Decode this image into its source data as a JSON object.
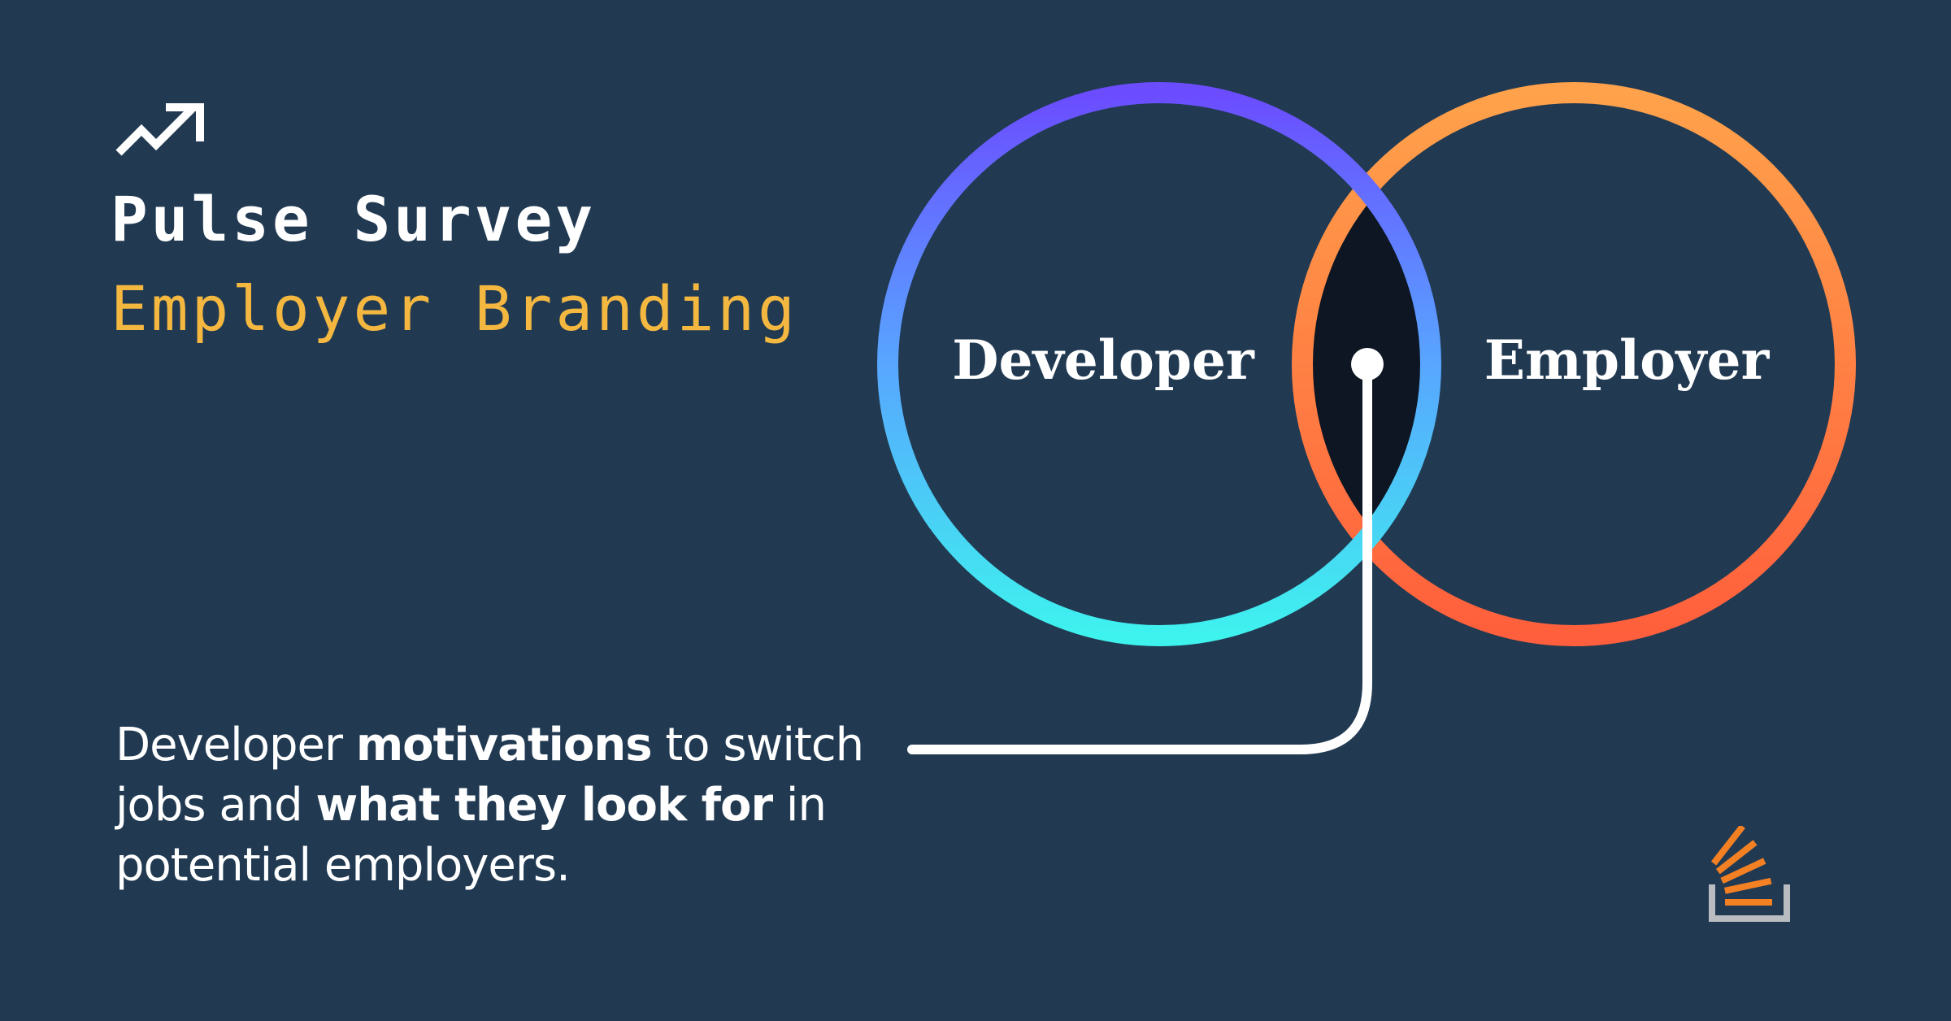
{
  "header": {
    "icon": "trending-up-icon",
    "title": "Pulse Survey",
    "subtitle": "Employer Branding"
  },
  "venn": {
    "left_label": "Developer",
    "right_label": "Employer",
    "left_gradient": [
      "#6b4cff",
      "#3ef2ee"
    ],
    "right_gradient": [
      "#ffa24b",
      "#ff5f3c"
    ],
    "overlap_color": "#0d1622"
  },
  "description": {
    "part1": "Developer ",
    "bold1": "motivations",
    "part2": " to switch jobs and ",
    "bold2": "what they look for",
    "part3": " in potential employers."
  },
  "colors": {
    "background": "#213a52",
    "accent": "#f4b740",
    "text": "#ffffff"
  },
  "logo": {
    "icon": "stack-overflow-logo-icon"
  }
}
